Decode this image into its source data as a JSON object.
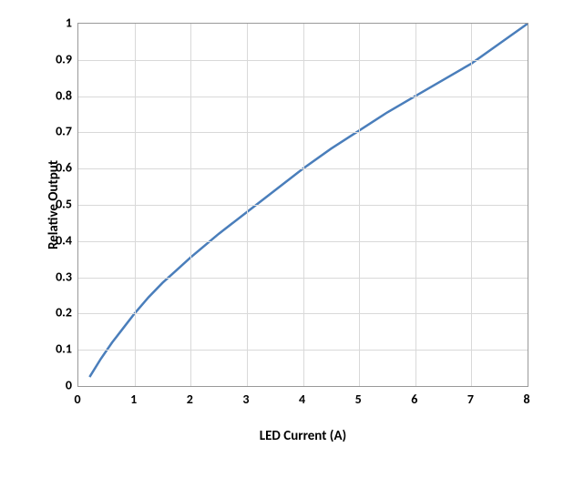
{
  "chart_data": {
    "type": "line",
    "xlabel": "LED Current (A)",
    "ylabel": "Relative Output",
    "xlim": [
      0,
      8
    ],
    "ylim": [
      0,
      1
    ],
    "x_ticks": [
      0,
      1,
      2,
      3,
      4,
      5,
      6,
      7,
      8
    ],
    "y_ticks": [
      0,
      0.1,
      0.2,
      0.3,
      0.4,
      0.5,
      0.6,
      0.7,
      0.8,
      0.9,
      1
    ],
    "series": [
      {
        "name": "Relative Output",
        "color": "#4a7ebb",
        "x": [
          0.2,
          0.4,
          0.6,
          0.8,
          1.0,
          1.25,
          1.5,
          1.75,
          2.0,
          2.5,
          3.0,
          3.5,
          4.0,
          4.5,
          5.0,
          5.5,
          6.0,
          6.5,
          7.0,
          7.5,
          8.0
        ],
        "y": [
          0.025,
          0.075,
          0.12,
          0.16,
          0.2,
          0.245,
          0.285,
          0.32,
          0.355,
          0.42,
          0.48,
          0.54,
          0.6,
          0.655,
          0.705,
          0.755,
          0.8,
          0.845,
          0.89,
          0.945,
          1.0
        ]
      }
    ]
  }
}
